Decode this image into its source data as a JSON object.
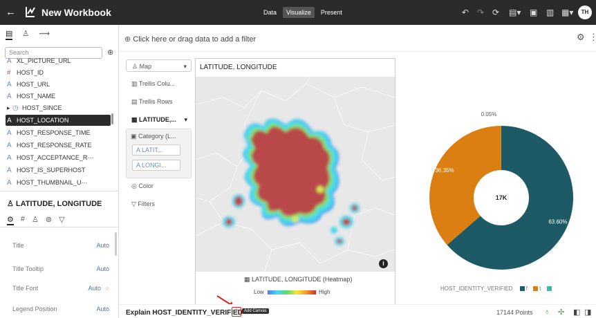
{
  "app": {
    "title": "New Workbook",
    "modes": [
      "Data",
      "Visualize",
      "Present"
    ],
    "active_mode": "Visualize",
    "avatar_initials": "TH"
  },
  "data_panel": {
    "search_placeholder": "Search",
    "items": [
      {
        "type": "A",
        "label": "XL_PICTURE_URL"
      },
      {
        "type": "#",
        "label": "HOST_ID"
      },
      {
        "type": "A",
        "label": "HOST_URL"
      },
      {
        "type": "A",
        "label": "HOST_NAME"
      },
      {
        "type": "◷",
        "label": "HOST_SINCE"
      },
      {
        "type": "A",
        "label": "HOST_LOCATION"
      },
      {
        "type": "A",
        "label": "HOST_RESPONSE_TIME"
      },
      {
        "type": "A",
        "label": "HOST_RESPONSE_RATE"
      },
      {
        "type": "A",
        "label": "HOST_ACCEPTANCE_R···"
      },
      {
        "type": "A",
        "label": "HOST_IS_SUPERHOST"
      },
      {
        "type": "A",
        "label": "HOST_THUMBNAIL_U···"
      }
    ]
  },
  "properties": {
    "title": "LATITUDE, LONGITUDE",
    "rows": [
      {
        "label": "Title",
        "value": "Auto"
      },
      {
        "label": "Title Tooltip",
        "value": "Auto"
      },
      {
        "label": "Title Font",
        "value": "Auto"
      },
      {
        "label": "Legend Position",
        "value": "Auto"
      }
    ]
  },
  "canvas": {
    "filter_hint": "Click here or drag data to add a filter",
    "grammar": {
      "viz_type": "Map",
      "trellis_columns": "Trellis Colu...",
      "trellis_rows": "Trellis Rows",
      "layer": "LATITUDE,...",
      "category": "Category (L...",
      "pills": [
        "LATIT...",
        "LONGI..."
      ],
      "color": "Color",
      "filters": "Filters"
    },
    "map": {
      "title": "LATITUDE, LONGITUDE",
      "legend_title": "LATITUDE, LONGITUDE (Heatmap)",
      "low": "Low",
      "high": "High",
      "info": "i"
    }
  },
  "chart_data": {
    "type": "pie",
    "title": "",
    "center_label": "17K",
    "categories": [
      "f",
      "t",
      ""
    ],
    "values": [
      63.6,
      36.35,
      0.05
    ],
    "labels": [
      "63.60%",
      "36.35%",
      "0.05%"
    ],
    "colors": [
      "#1e5a66",
      "#dc7f12",
      "#3fb8a6"
    ],
    "legend_title": "HOST_IDENTITY_VERIFIED",
    "legend_labels": [
      "f",
      "t"
    ]
  },
  "bottom": {
    "explain": "Explain HOST_IDENTITY_VERIFIED",
    "add_canvas_tooltip": "Add Canvas",
    "points": "17144 Points"
  }
}
